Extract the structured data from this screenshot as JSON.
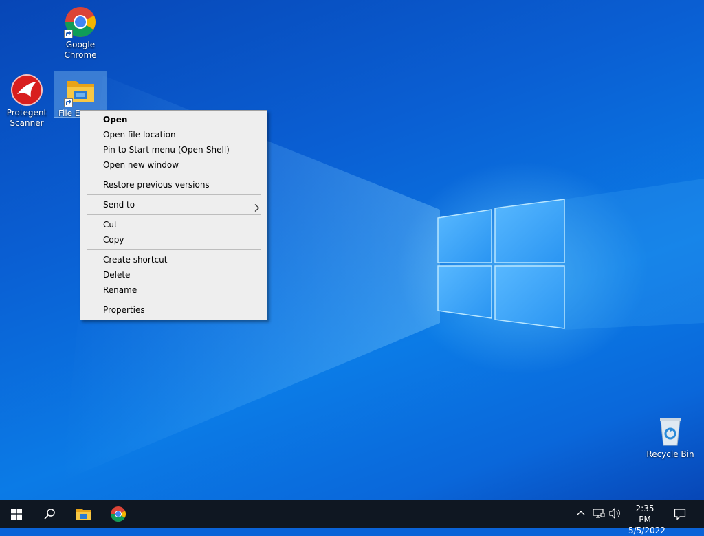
{
  "desktop": {
    "icons": [
      {
        "label_line1": "Google",
        "label_line2": "Chrome"
      },
      {
        "label_line1": "Protegent",
        "label_line2": "Scanner"
      },
      {
        "label_line1": "File Ex",
        "label_line2": ""
      },
      {
        "label_line1": "Recycle Bin",
        "label_line2": ""
      }
    ]
  },
  "context_menu": {
    "items": [
      {
        "label": "Open"
      },
      {
        "label": "Open file location"
      },
      {
        "label": "Pin to Start menu (Open-Shell)"
      },
      {
        "label": "Open new window"
      },
      {
        "label": "Restore previous versions"
      },
      {
        "label": "Send to"
      },
      {
        "label": "Cut"
      },
      {
        "label": "Copy"
      },
      {
        "label": "Create shortcut"
      },
      {
        "label": "Delete"
      },
      {
        "label": "Rename"
      },
      {
        "label": "Properties"
      }
    ]
  },
  "taskbar": {
    "start_icon": "windows-logo-icon",
    "search_icon": "search-icon",
    "pinned": [
      "file-explorer-icon",
      "chrome-icon"
    ],
    "tray_icons": [
      "chevron-up-icon",
      "network-icon",
      "volume-icon",
      "notification-icon"
    ],
    "clock_time": "2:35 PM",
    "clock_date": "5/5/2022"
  },
  "colors": {
    "taskbar": "#0f1722",
    "menu_bg": "#eeeeee",
    "desktop_blue": "#0a63d8"
  }
}
